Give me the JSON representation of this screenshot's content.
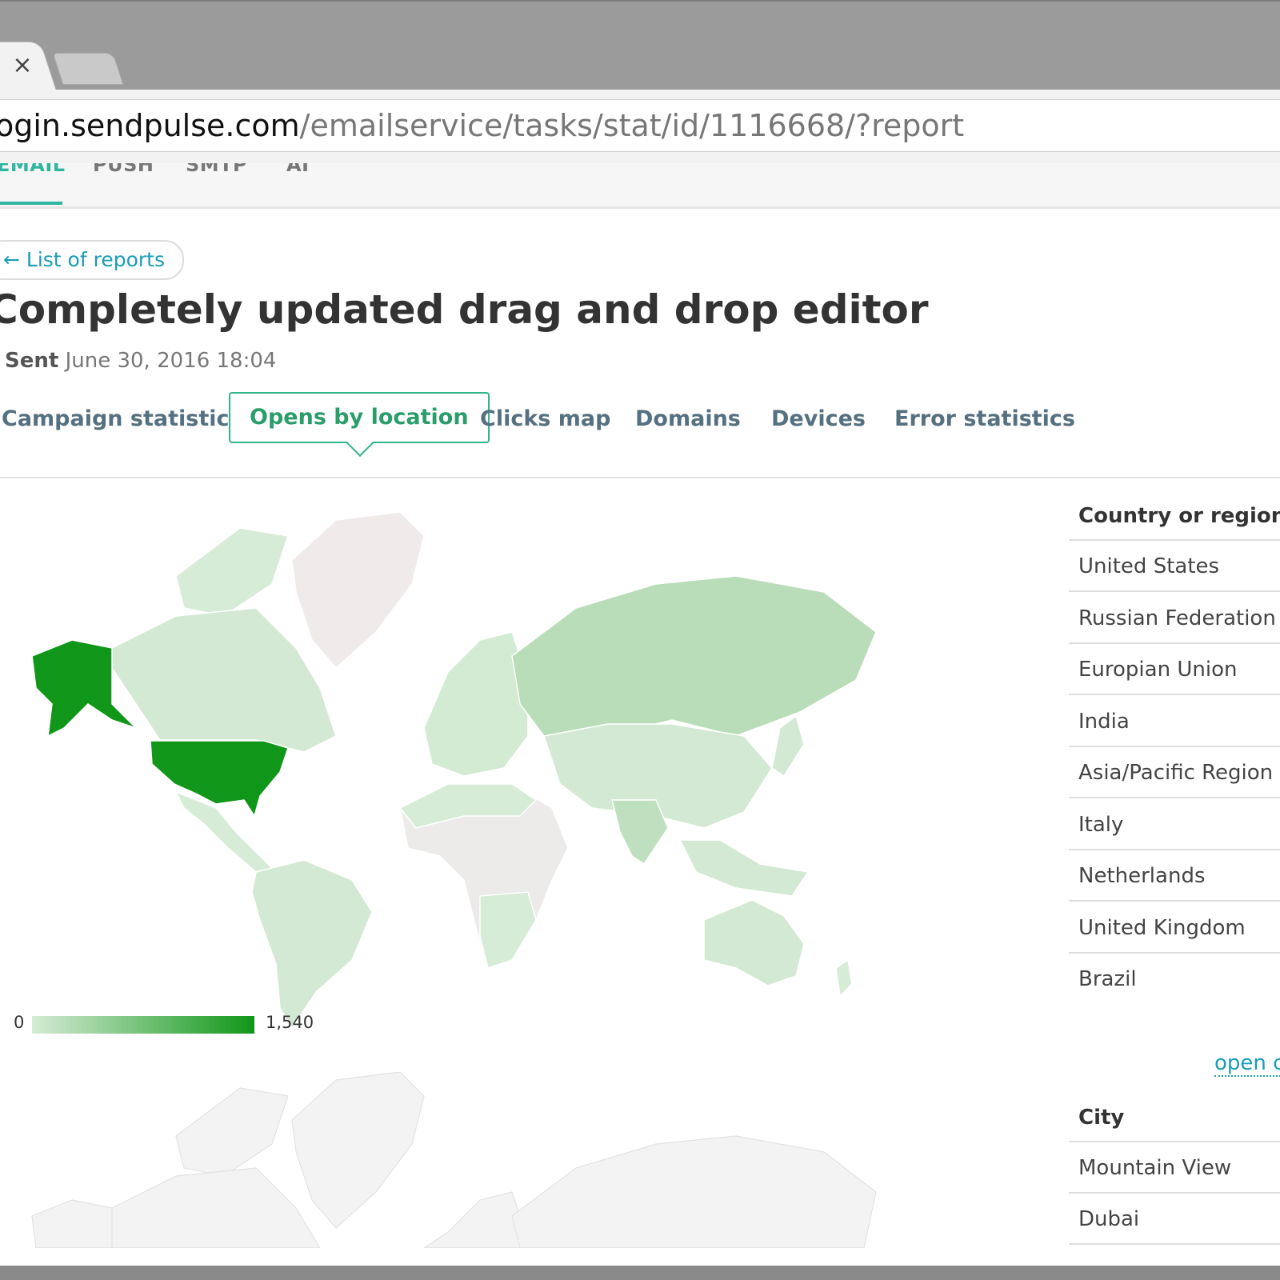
{
  "browser": {
    "tab_close": "×",
    "url_host": "ogin.sendpulse.com",
    "url_path": "/emailservice/tasks/stat/id/1116668/?report"
  },
  "service_nav": {
    "items": [
      "EMAIL",
      "PUSH",
      "SMTP",
      "AI"
    ],
    "active": "EMAIL"
  },
  "back_link": "← List of reports",
  "page_title": "Completely updated drag and drop editor",
  "sent": {
    "label": "Sent",
    "date": "June 30, 2016 18:04"
  },
  "report_tabs": [
    "Campaign statistics",
    "Opens by location",
    "Clicks map",
    "Domains",
    "Devices",
    "Error statistics"
  ],
  "active_report_tab": "Opens by location",
  "map": {
    "legend_min": "0",
    "legend_max": "1,540",
    "color_low": "#d6ecd6",
    "color_high": "#109618",
    "color_nodata": "#f0eaea"
  },
  "country_table": {
    "header": "Country or region",
    "rows": [
      "United States",
      "Russian Federation",
      "Europian Union",
      "India",
      "Asia/Pacific Region",
      "Italy",
      "Netherlands",
      "United Kingdom",
      "Brazil"
    ]
  },
  "open_link": "open c",
  "city_table": {
    "header": "City",
    "rows": [
      "Mountain View",
      "Dubai"
    ]
  },
  "colors": {
    "accent": "#2fb58a",
    "link": "#1a9cb7"
  }
}
